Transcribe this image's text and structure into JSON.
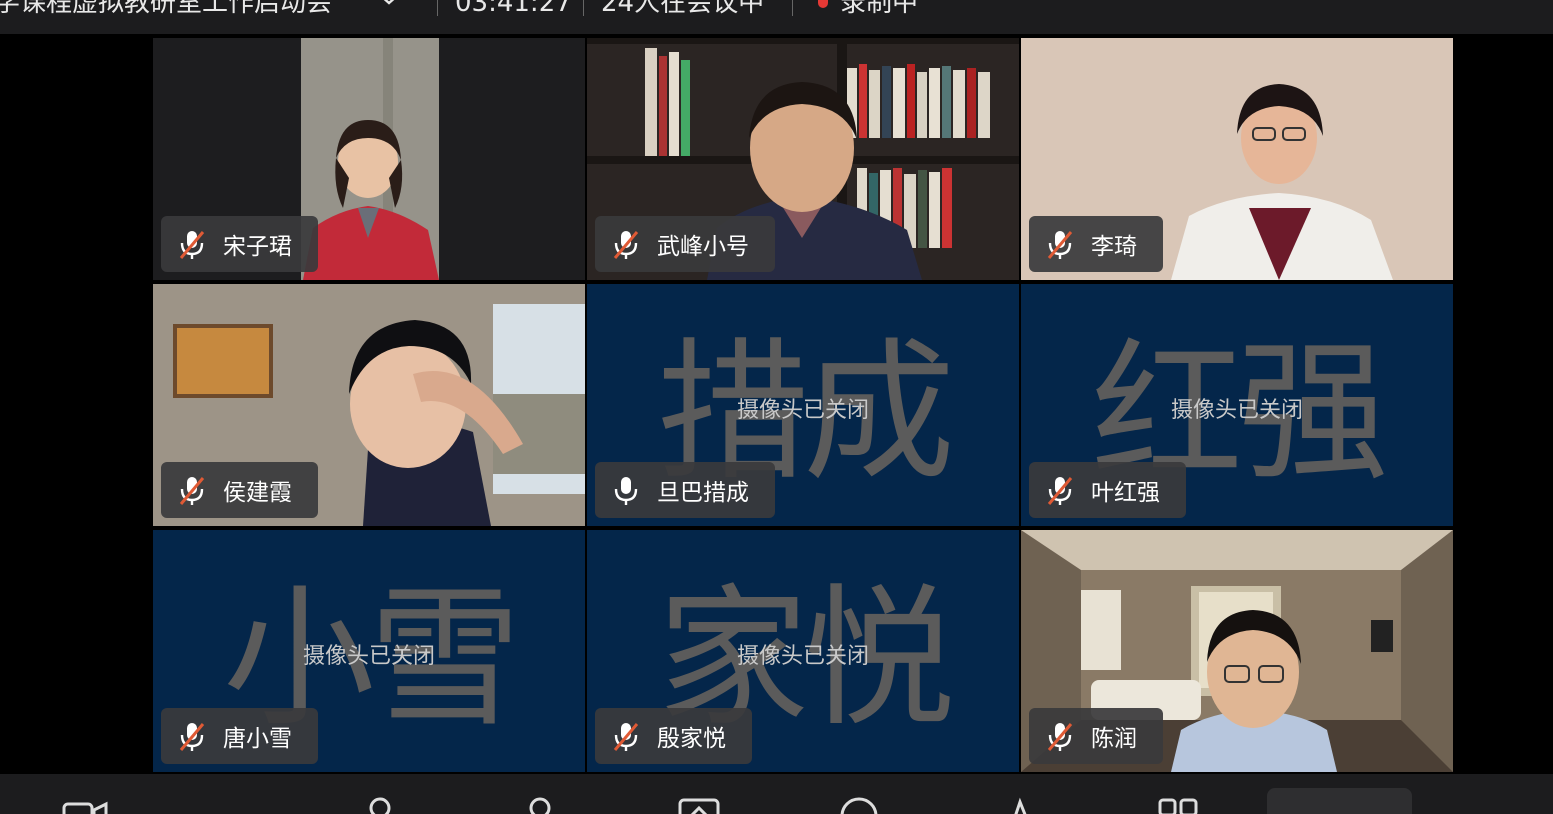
{
  "header": {
    "meeting_title": "学课程虚拟教研室工作启动会",
    "elapsed_time": "03:41:27",
    "attendee_count": "24人在会议中",
    "recording_status": "录制中",
    "recording_color": "#e53935"
  },
  "participants": [
    {
      "name": "宋子珺",
      "mic": "muted",
      "camera": "on"
    },
    {
      "name": "武峰小号",
      "mic": "muted",
      "camera": "on"
    },
    {
      "name": "李琦",
      "mic": "muted",
      "camera": "on"
    },
    {
      "name": "侯建霞",
      "mic": "muted",
      "camera": "on"
    },
    {
      "name": "旦巴措成",
      "mic": "unmuted",
      "camera": "off",
      "avatar_text": "措成"
    },
    {
      "name": "叶红强",
      "mic": "muted",
      "camera": "off",
      "avatar_text": "红强"
    },
    {
      "name": "唐小雪",
      "mic": "muted",
      "camera": "off",
      "avatar_text": "小雪"
    },
    {
      "name": "殷家悦",
      "mic": "muted",
      "camera": "off",
      "avatar_text": "家悦"
    },
    {
      "name": "陈润",
      "mic": "muted",
      "camera": "on"
    }
  ],
  "camera_off_label": "摄像头已关闭",
  "icons": {
    "mic_muted": "mic-muted-icon",
    "mic_on": "mic-icon",
    "dropdown": "chevron-down-icon",
    "recording": "recording-dot-icon"
  },
  "toolbar_icons": [
    "video-camera-icon",
    "participants-icon",
    "invite-icon",
    "share-screen-icon",
    "chat-icon",
    "reactions-icon",
    "layout-grid-icon"
  ],
  "colors": {
    "camera_off_bg": "#04264a",
    "mute_slash": "#e05a35",
    "name_tag_bg": "#3a3a3c"
  }
}
